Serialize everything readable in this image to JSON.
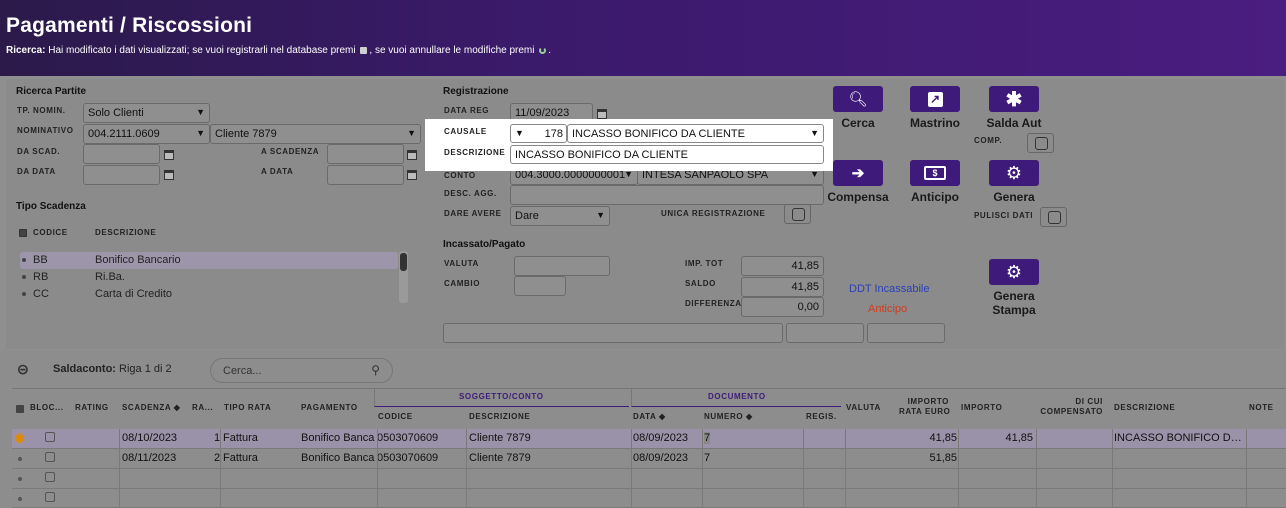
{
  "header": {
    "title": "Pagamenti / Riscossioni",
    "msg_bold": "Ricerca:",
    "msg_text1": "Hai modificato i dati visualizzati; se vuoi registrarli nel database premi",
    "msg_text2": ", se vuoi annullare le modifiche premi",
    "msg_end": "."
  },
  "ricerca": {
    "section": "Ricerca Partite",
    "tp_nomin_label": "TP. NOMIN.",
    "tp_nomin_value": "Solo Clienti",
    "nominativo_label": "NOMINATIVO",
    "nominativo_code": "004.2111.0609",
    "nominativo_name": "Cliente 7879",
    "da_scad_label": "DA SCAD.",
    "a_scadenza_label": "A SCADENZA",
    "da_data_label": "DA DATA",
    "a_data_label": "A DATA"
  },
  "tipo_scadenza": {
    "section": "Tipo Scadenza",
    "col_codice": "CODICE",
    "col_descrizione": "DESCRIZIONE",
    "items": [
      {
        "code": "BB",
        "desc": "Bonifico Bancario"
      },
      {
        "code": "RB",
        "desc": "Ri.Ba."
      },
      {
        "code": "CC",
        "desc": "Carta di Credito"
      }
    ]
  },
  "registrazione": {
    "section": "Registrazione",
    "data_reg_label": "DATA REG",
    "data_reg_value": "11/09/2023",
    "causale_label": "CAUSALE",
    "causale_code": "178",
    "causale_desc": "INCASSO BONIFICO DA CLIENTE",
    "descrizione_label": "DESCRIZIONE",
    "descrizione_value": "INCASSO BONIFICO DA CLIENTE",
    "conto_label": "CONTO",
    "conto_code": "004.3000.0000000001",
    "conto_name": "INTESA SANPAOLO SPA",
    "desc_agg_label": "DESC. AGG.",
    "dare_avere_label": "DARE AVERE",
    "dare_avere_value": "Dare",
    "unica_label": "UNICA REGISTRAZIONE"
  },
  "incassato": {
    "section": "Incassato/Pagato",
    "valuta_label": "VALUTA",
    "cambio_label": "CAMBIO",
    "imp_tot_label": "IMP. TOT",
    "imp_tot_value": "41,85",
    "saldo_label": "SALDO",
    "saldo_value": "41,85",
    "differenza_label": "DIFFERENZA",
    "differenza_value": "0,00",
    "ddt_link": "DDT Incassabile",
    "anticipo_link": "Anticipo"
  },
  "actions": {
    "cerca": "Cerca",
    "mastrino": "Mastrino",
    "saldaaut": "Salda Aut",
    "comp_label": "COMP.",
    "compensa": "Compensa",
    "anticipo": "Anticipo",
    "genera": "Genera",
    "pulisci_label": "PULISCI DATI",
    "genera_stampa_1": "Genera",
    "genera_stampa_2": "Stampa"
  },
  "saldaconto": {
    "title": "Saldaconto:",
    "subtitle": "Riga 1 di 2",
    "search_placeholder": "Cerca...",
    "group_soggetto": "SOGGETTO/CONTO",
    "group_documento": "DOCUMENTO",
    "headers": {
      "bloc": "BLOC...",
      "rating": "RATING",
      "scadenza": "SCADENZA",
      "ra": "RA...",
      "tipo_rata": "TIPO RATA",
      "pagamento": "PAGAMENTO",
      "codice": "CODICE",
      "descrizione": "DESCRIZIONE",
      "data": "DATA",
      "numero": "NUMERO",
      "regis": "REGIS.",
      "valuta": "VALUTA",
      "importo_rata_1": "IMPORTO",
      "importo_rata_2": "RATA EURO",
      "importo": "IMPORTO",
      "dicui_1": "DI CUI",
      "dicui_2": "COMPENSATO",
      "descrizione2": "DESCRIZIONE",
      "note": "NOTE"
    },
    "rows": [
      {
        "scadenza": "08/10/2023",
        "ra": "1",
        "tipo": "Fattura",
        "pagamento": "Bonifico Bancario",
        "codice": "0503070609",
        "descr": "Cliente 7879",
        "data": "08/09/2023",
        "numero": "7",
        "imp_rata": "41,85",
        "importo": "41,85",
        "descr2": "INCASSO BONIFICO DA CLIENTE"
      },
      {
        "scadenza": "08/11/2023",
        "ra": "2",
        "tipo": "Fattura",
        "pagamento": "Bonifico Bancario",
        "codice": "0503070609",
        "descr": "Cliente 7879",
        "data": "08/09/2023",
        "numero": "7",
        "imp_rata": "51,85",
        "importo": "",
        "descr2": ""
      }
    ]
  },
  "icons": [
    "search-icon",
    "external-link-icon",
    "asterisk-icon",
    "enter-icon",
    "money-icon",
    "gears-icon",
    "calendar-icon",
    "collapse-icon"
  ]
}
